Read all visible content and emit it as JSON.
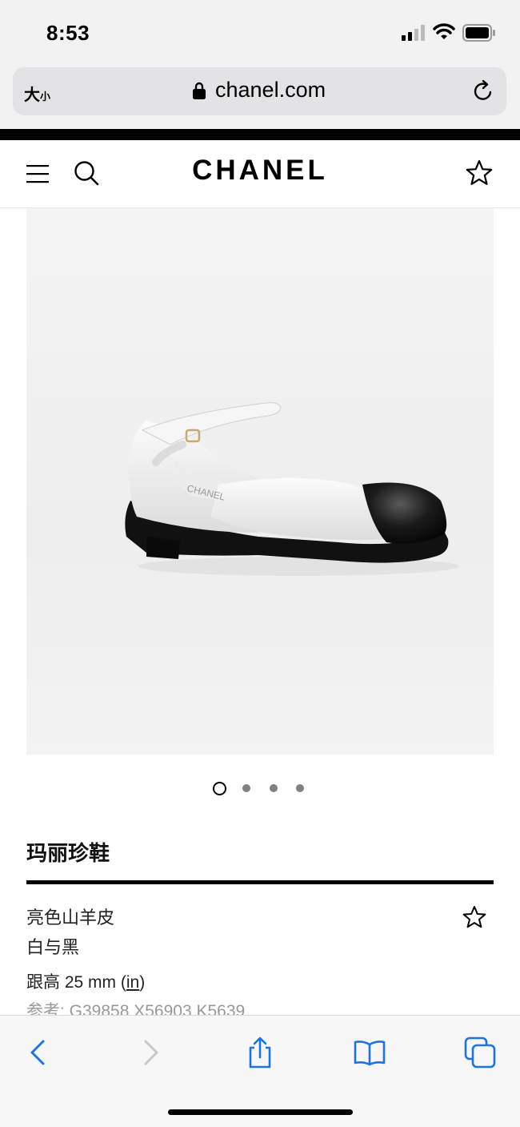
{
  "status": {
    "time": "8:53"
  },
  "browser": {
    "text_size_label": "大",
    "text_size_small": "小",
    "domain": "chanel.com"
  },
  "site": {
    "logo": "CHANEL"
  },
  "product": {
    "title": "玛丽珍鞋",
    "material": "亮色山羊皮",
    "color": "白与黑",
    "heel_prefix": "跟高 25 mm (",
    "heel_link": "in",
    "heel_suffix": ")",
    "reference": "参考: G39858 X56903 K5639",
    "image_count": 4,
    "active_image": 1
  },
  "colors": {
    "accent_blue": "#1a73e8",
    "disabled_gray": "#c7c7cc"
  }
}
